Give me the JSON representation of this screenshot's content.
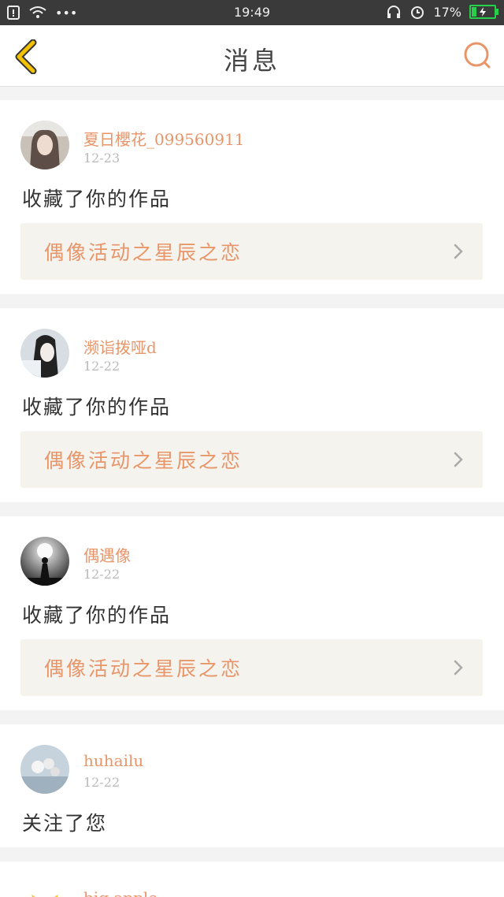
{
  "status_bar": {
    "time": "19:49",
    "battery": "17%",
    "dots": "•••",
    "icons": [
      "sim-alert-icon",
      "wifi-icon",
      "headset-icon",
      "alarm-icon",
      "battery-charging-icon"
    ]
  },
  "header": {
    "title": "消息",
    "back_icon": "chevron-left-icon",
    "search_icon": "search-icon",
    "accent": "#e8956a",
    "back_color": "#f2c200"
  },
  "notifications": [
    {
      "user": "夏日櫻花_099560911",
      "date": "12-23",
      "action": "收藏了你的作品",
      "work": "偶像活动之星辰之恋"
    },
    {
      "user": "濒诣拨哑d",
      "date": "12-22",
      "action": "收藏了你的作品",
      "work": "偶像活动之星辰之恋"
    },
    {
      "user": "偶遇像",
      "date": "12-22",
      "action": "收藏了你的作品",
      "work": "偶像活动之星辰之恋"
    },
    {
      "user": "huhailu",
      "date": "12-22",
      "action": "关注了您"
    },
    {
      "user": "big apple"
    }
  ]
}
